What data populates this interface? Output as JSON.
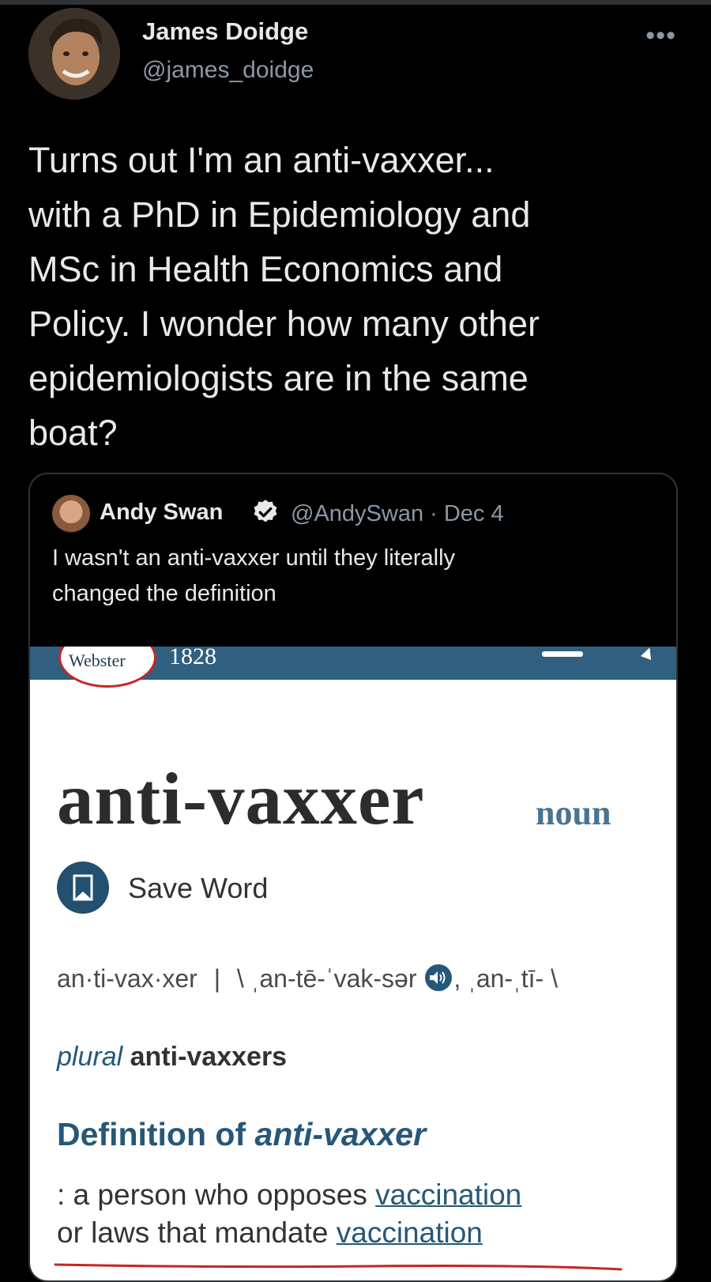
{
  "tweet": {
    "author_name": "James Doidge",
    "author_handle": "@james_doidge",
    "more_icon": "more-horizontal-icon",
    "text": "Turns out I'm an anti-vaxxer...\nwith a PhD in Epidemiology and\nMSc in Health Economics and\nPolicy. I wonder how many other\nepidemiologists are in the same\nboat?"
  },
  "quoted_tweet": {
    "author_name": "Andy Swan",
    "verified_icon": "verified-badge-icon",
    "handle_and_date": "@AndySwan · Dec 4",
    "text": "I wasn't an anti-vaxxer until they literally\nchanged the definition"
  },
  "dictionary": {
    "logo_text": "Webster",
    "header_year": "1828",
    "headword": "anti-vaxxer",
    "part_of_speech": "noun",
    "save_label": "Save Word",
    "syllables": "an·ti-vax·xer",
    "separator": "|",
    "pronunciation_1": "\\ ˌan-tē-ˈvak-sər",
    "pronunciation_2": ", ˌan-ˌtī- \\",
    "plural_label": "plural",
    "plural_form": "anti-vaxxers",
    "definition_heading_prefix": "Definition of ",
    "definition_heading_word": "anti-vaxxer",
    "definition_lead": ": a person who opposes ",
    "definition_link_1": "vaccination",
    "definition_middle": " or laws that mandate ",
    "definition_link_2": "vaccination",
    "colors": {
      "header_bar": "#305f80",
      "accent_blue": "#265779",
      "underline_red": "#c82525"
    }
  }
}
